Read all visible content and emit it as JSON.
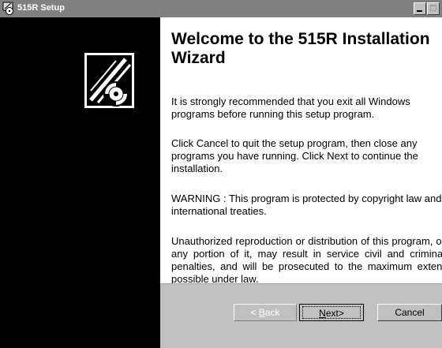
{
  "window": {
    "title": "515R Setup",
    "controls": {
      "minimize": "minimize",
      "maximize": "maximize"
    }
  },
  "content": {
    "heading": "Welcome to the 515R Installation Wizard",
    "paragraphs": [
      "It is strongly recommended that you exit all Windows programs before running this setup program.",
      "Click Cancel to quit the setup program, then close any programs you have running.  Click Next to continue the installation.",
      "WARNING : This program is protected by copyright law and international treaties.",
      "Unauthorized reproduction or distribution of this program, or any portion of it, may result in service civil and criminal penalties, and will be prosecuted to the maximum extent possible under law."
    ]
  },
  "buttons": {
    "back": {
      "prefix": "< ",
      "underlined": "B",
      "rest": "ack",
      "enabled": false
    },
    "next": {
      "underlined": "N",
      "rest": "ext>"
    },
    "cancel": {
      "label": "Cancel"
    }
  },
  "icons": {
    "app_icon": "setup-disc-icon",
    "wizard_logo": "install-disc-logo-icon"
  },
  "colors": {
    "titlebar": "#808080",
    "left_panel": "#000000",
    "content_bg": "#ffffff",
    "button_face": "#c0c0c0"
  }
}
